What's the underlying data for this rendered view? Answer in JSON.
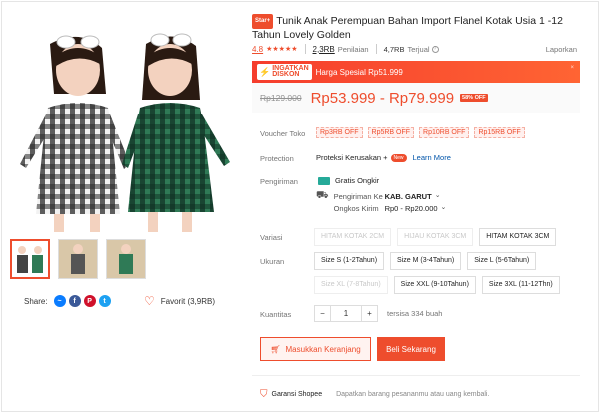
{
  "product": {
    "badge": "Star+",
    "title": "Tunik Anak Perempuan Bahan Import Flanel Kotak Usia 1 -12 Tahun Lovely Golden",
    "rating": "4.8",
    "stars": "★★★★★",
    "rating_count": "2,3RB",
    "rating_label": "Penilaian",
    "sold_count": "4,7RB",
    "sold_label": "Terjual",
    "report_label": "Laporkan"
  },
  "flash_sale": {
    "logo_line1": "INGATKAN",
    "logo_line2": "DISKON",
    "text": "Harga Spesial Rp51.999"
  },
  "price": {
    "original": "Rp129.000",
    "range": "Rp53.999 - Rp79.999",
    "discount": "58% OFF"
  },
  "vouchers": {
    "label": "Voucher Toko",
    "items": [
      "Rp3RB OFF",
      "Rp5RB OFF",
      "Rp10RB OFF",
      "Rp15RB OFF"
    ]
  },
  "protection": {
    "label": "Protection",
    "text": "Proteksi Kerusakan +",
    "new_badge": "New",
    "more": "Learn More"
  },
  "shipping": {
    "label": "Pengiriman",
    "free": "Gratis Ongkir",
    "to_label": "Pengiriman Ke",
    "to_value": "KAB. GARUT",
    "cost_label": "Ongkos Kirim",
    "cost_value": "Rp0 - Rp20.000"
  },
  "variation": {
    "label": "Variasi",
    "options": [
      {
        "name": "HITAM KOTAK 2CM",
        "disabled": true
      },
      {
        "name": "HIJAU KOTAK 3CM",
        "disabled": true
      },
      {
        "name": "HITAM KOTAK 3CM",
        "disabled": false
      }
    ]
  },
  "size": {
    "label": "Ukuran",
    "options": [
      {
        "name": "Size S (1-2Tahun)",
        "disabled": false
      },
      {
        "name": "Size M (3-4Tahun)",
        "disabled": false
      },
      {
        "name": "Size L (5-6Tahun)",
        "disabled": false
      },
      {
        "name": "Size XL (7-8Tahun)",
        "disabled": true
      },
      {
        "name": "Size XXL (9-10Tahun)",
        "disabled": false
      },
      {
        "name": "Size 3XL (11-12Thn)",
        "disabled": false
      }
    ]
  },
  "quantity": {
    "label": "Kuantitas",
    "minus": "−",
    "value": "1",
    "plus": "+",
    "stock": "tersisa 334 buah"
  },
  "actions": {
    "cart": "Masukkan Keranjang",
    "buy": "Beli Sekarang"
  },
  "guarantee": {
    "name": "Garansi Shopee",
    "desc": "Dapatkan barang pesananmu atau uang kembali."
  },
  "share": {
    "label": "Share:",
    "icons": [
      "messenger-icon",
      "facebook-icon",
      "pinterest-icon",
      "twitter-icon"
    ]
  },
  "favorite": {
    "label": "Favorit (3,9RB)"
  },
  "colors": {
    "accent": "#ee4d2d",
    "free_shipping": "#26aa99",
    "link": "#0055aa"
  }
}
